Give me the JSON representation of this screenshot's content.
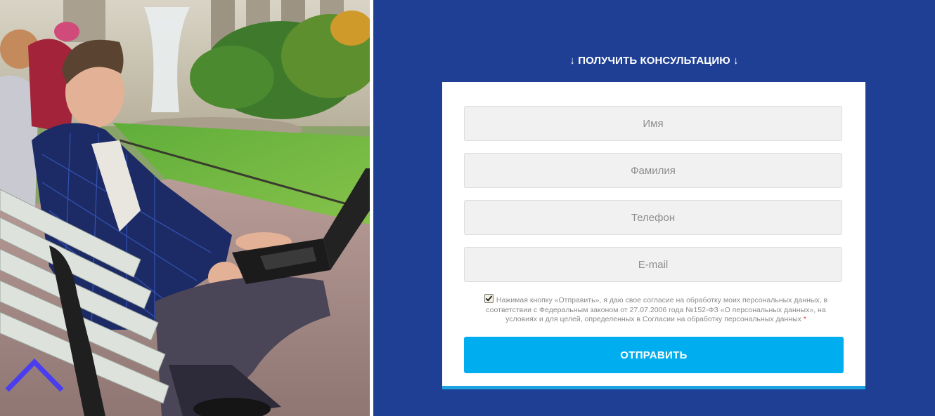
{
  "form": {
    "heading": "↓ ПОЛУЧИТЬ КОНСУЛЬТАЦИЮ ↓",
    "fields": {
      "name_placeholder": "Имя",
      "surname_placeholder": "Фамилия",
      "phone_placeholder": "Телефон",
      "email_placeholder": "E-mail"
    },
    "consent": {
      "checked": true,
      "text": "Нажимая кнопку «Отправить», я даю свое согласие на обработку моих персональных данных, в соответствии с Федеральным законом от 27.07.2006 года №152-ФЗ «О персональных данных», на условиях и для целей, определенных в Согласии на обработку персональных данных",
      "required_marker": "*"
    },
    "submit_label": "ОТПРАВИТЬ"
  },
  "photo": {
    "icon": "person-with-laptop-on-bench-photo"
  },
  "scroll_top": {
    "icon": "chevron-up-icon"
  },
  "colors": {
    "background": "#1e3f94",
    "card": "#ffffff",
    "input_bg": "#f1f1f1",
    "button": "#00aef0",
    "card_accent": "#1ea3e0",
    "scroll_arrow": "#4a3df0",
    "required": "#e53935"
  }
}
